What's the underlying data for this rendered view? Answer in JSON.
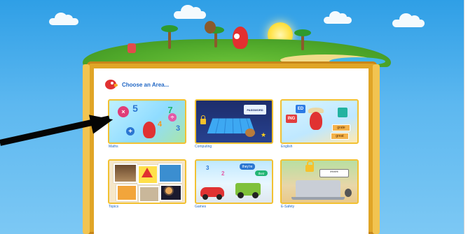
{
  "header": {
    "title": "Choose an Area..."
  },
  "tiles": [
    {
      "key": "maths",
      "label": "Maths"
    },
    {
      "key": "computing",
      "label": "Computing",
      "password_text": "PASSWORD"
    },
    {
      "key": "english",
      "label": "English",
      "word1": "grate",
      "word2": "great",
      "book1": "ED",
      "book2": "ING"
    },
    {
      "key": "topics",
      "label": "Topics"
    },
    {
      "key": "games",
      "label": "Games",
      "bubble1": "they're",
      "bubble2": "their"
    },
    {
      "key": "esafety",
      "label": "E-Safety",
      "password_dots": "*****"
    }
  ],
  "maths_symbols": {
    "times": "×",
    "five": "5",
    "seven": "7",
    "four": "4",
    "three": "3",
    "divide": "÷",
    "plus": "+"
  },
  "games_numbers": {
    "n1": "3",
    "n2": "2"
  },
  "colors": {
    "sky": "#2f9fe6",
    "board": "#e0a526",
    "tile_border": "#f2c132",
    "label": "#1f66c4",
    "arrow": "#050505"
  }
}
